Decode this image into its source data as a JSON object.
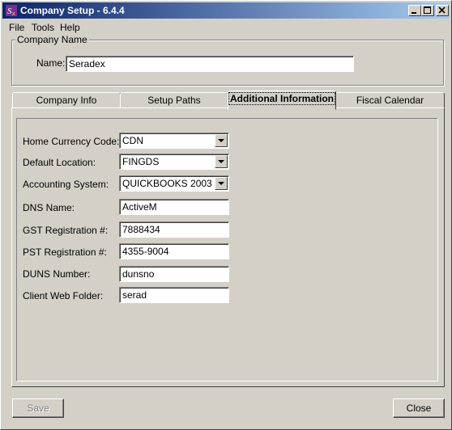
{
  "window": {
    "title": "Company Setup - 6.4.4"
  },
  "menu": [
    {
      "label": "File"
    },
    {
      "label": "Tools"
    },
    {
      "label": "Help"
    }
  ],
  "company": {
    "group_label": "Company Name",
    "name_label": "Name:",
    "name_value": "Seradex"
  },
  "tabs": [
    {
      "label": "Company Info"
    },
    {
      "label": "Setup Paths"
    },
    {
      "label": "Additional Information"
    },
    {
      "label": "Fiscal Calendar"
    }
  ],
  "active_tab": "Additional Information",
  "fields": [
    {
      "label": "Home Currency Code:",
      "value": "CDN",
      "type": "dropdown"
    },
    {
      "label": "Default Location:",
      "value": "FINGDS",
      "type": "dropdown"
    },
    {
      "label": "Accounting System:",
      "value": "QUICKBOOKS 2003",
      "type": "dropdown"
    },
    {
      "label": "DNS Name:",
      "value": "ActiveM",
      "type": "text"
    },
    {
      "label": "GST Registration #:",
      "value": "7888434",
      "type": "text"
    },
    {
      "label": "PST Registration #:",
      "value": "4355-9004",
      "type": "text"
    },
    {
      "label": "DUNS Number:",
      "value": "dunsno",
      "type": "text"
    },
    {
      "label": "Client Web Folder:",
      "value": "serad",
      "type": "text"
    }
  ],
  "buttons": {
    "save": "Save",
    "close": "Close",
    "save_enabled": false
  },
  "colors": {
    "titlebar_start": "#0a246a",
    "titlebar_end": "#a6caf0",
    "window_bg": "#d4d0c8"
  }
}
